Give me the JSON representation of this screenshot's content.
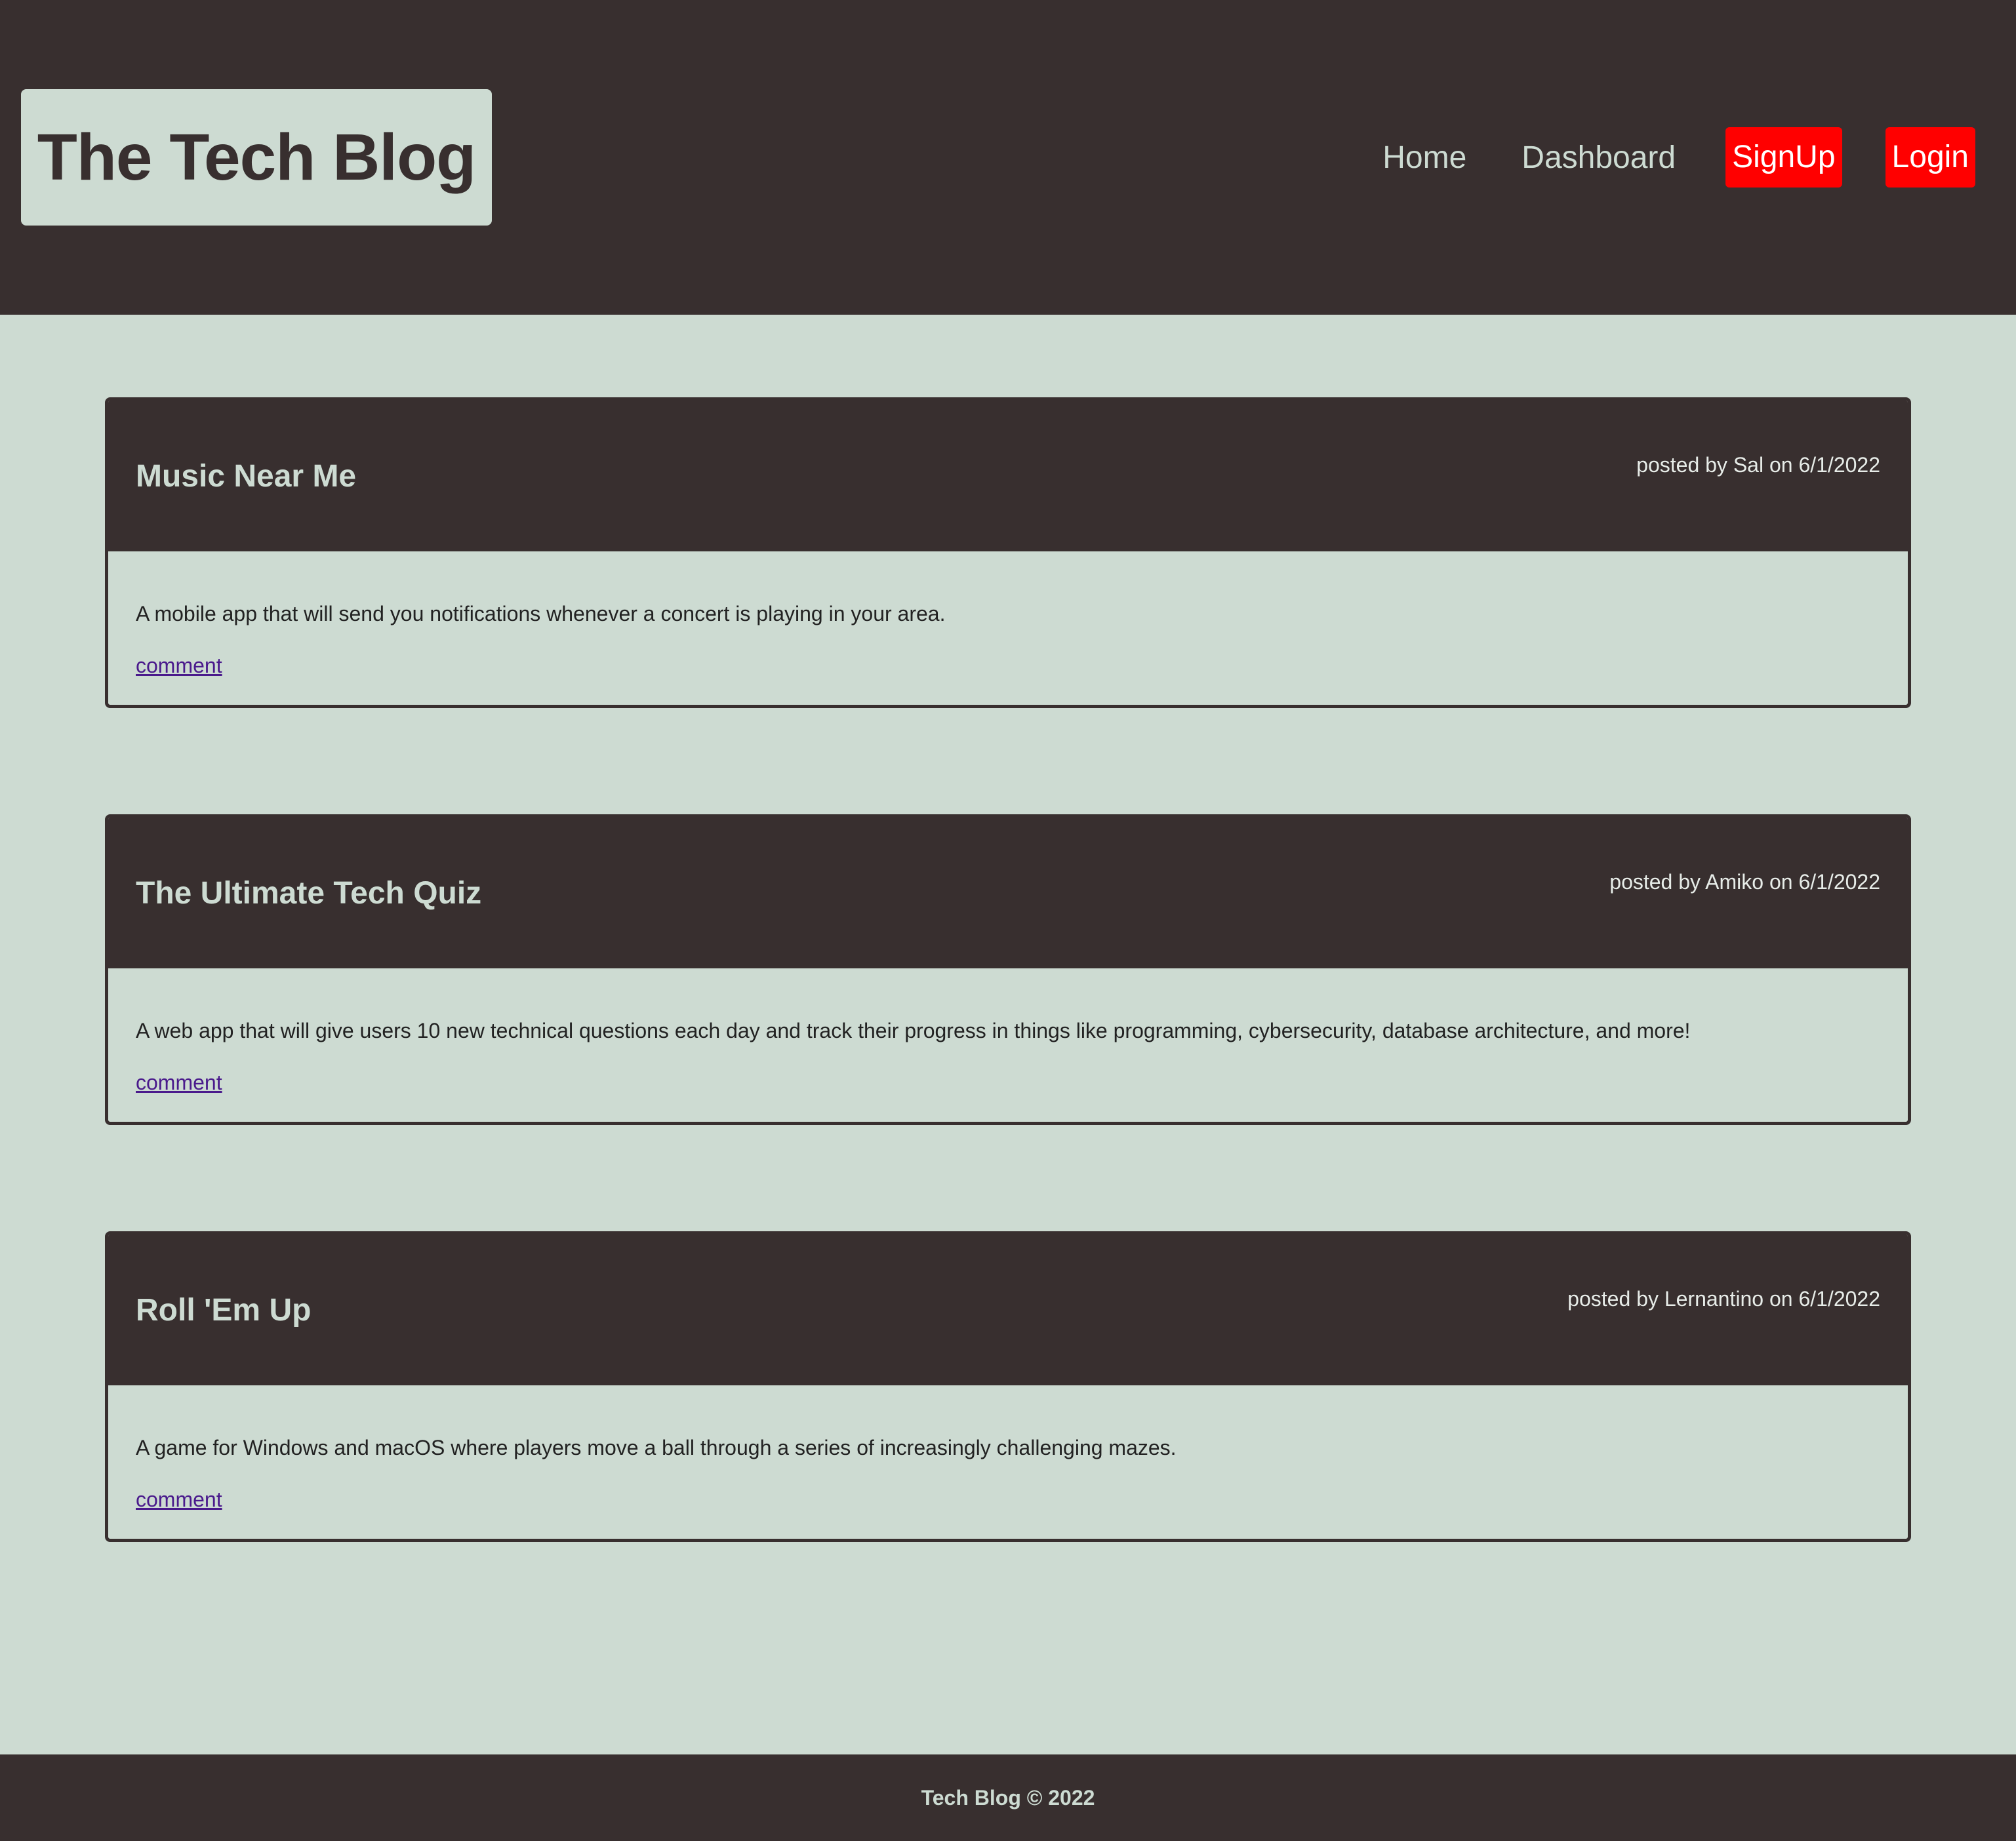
{
  "header": {
    "title": "The Tech Blog",
    "nav": {
      "home": "Home",
      "dashboard": "Dashboard",
      "signup": "SignUp",
      "login": "Login"
    }
  },
  "posts": [
    {
      "title": "Music Near Me",
      "meta": "posted by Sal on 6/1/2022",
      "content": "A mobile app that will send you notifications whenever a concert is playing in your area.",
      "link": "comment"
    },
    {
      "title": "The Ultimate Tech Quiz",
      "meta": "posted by Amiko on 6/1/2022",
      "content": "A web app that will give users 10 new technical questions each day and track their progress in things like programming, cybersecurity, database architecture, and more!",
      "link": "comment"
    },
    {
      "title": "Roll 'Em Up",
      "meta": "posted by Lernantino on 6/1/2022",
      "content": "A game for Windows and macOS where players move a ball through a series of increasingly challenging mazes.",
      "link": "comment"
    }
  ],
  "footer": {
    "text": "Tech Blog © 2022"
  },
  "colors": {
    "dark": "#382f2f",
    "light": "#cddbd2",
    "button": "#ff0000",
    "link": "#4a1a8c"
  }
}
